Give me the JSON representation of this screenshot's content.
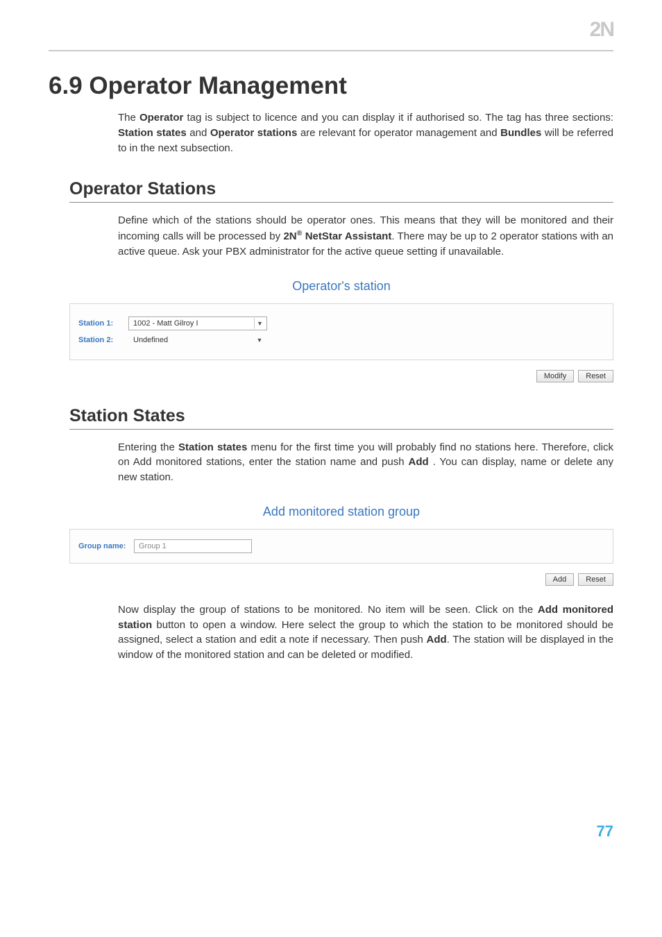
{
  "logo_text": "2N",
  "title": "6.9 Operator Management",
  "intro_a": "The ",
  "intro_bold1": "Operator",
  "intro_b": " tag is subject to licence and you can display it if authorised so. The tag has three sections: ",
  "intro_bold2": "Station states",
  "intro_c": " and ",
  "intro_bold3": "Operator stations",
  "intro_d": " are relevant for operator management and ",
  "intro_bold4": "Bundles",
  "intro_e": " will be referred to in the next subsection.",
  "sec1": {
    "heading": "Operator Stations",
    "p1_a": "Define which of the stations should be operator ones. This means that they will be monitored and their incoming calls will be processed by ",
    "p1_bold1": "2N",
    "p1_bold2": " NetStar Assistant",
    "p1_b": ". There may be up to 2 operator stations with an active queue. Ask your PBX administrator for the active queue setting if unavailable.",
    "panel_title": "Operator's station",
    "station1_label": "Station 1:",
    "station1_value": "1002 - Matt Gilroy I",
    "station2_label": "Station 2:",
    "station2_value": "Undefined",
    "modify_label": "Modify",
    "reset_label": "Reset"
  },
  "sec2": {
    "heading": "Station States",
    "p1_a": "Entering the ",
    "p1_bold1": "Station states",
    "p1_b": " menu for the first time you will probably find no stations here. Therefore, click on Add monitored stations, enter the station name and push ",
    "p1_bold2": "Add",
    "p1_c": " . You can display, name or delete any new station.",
    "panel_title": "Add monitored station group",
    "group_label": "Group name:",
    "group_value": "Group 1",
    "add_label": "Add",
    "reset_label": "Reset",
    "p2_a": "Now display the group of stations to be monitored. No item will be seen. Click on the ",
    "p2_bold1": "Add monitored station",
    "p2_b": " button to open a window. Here select the group to which the station to be monitored should be assigned, select a station and edit a note if necessary. Then push ",
    "p2_bold2": "Add",
    "p2_c": ". The station will be displayed in the window of the monitored station and can be deleted or modified."
  },
  "page_number": "77"
}
